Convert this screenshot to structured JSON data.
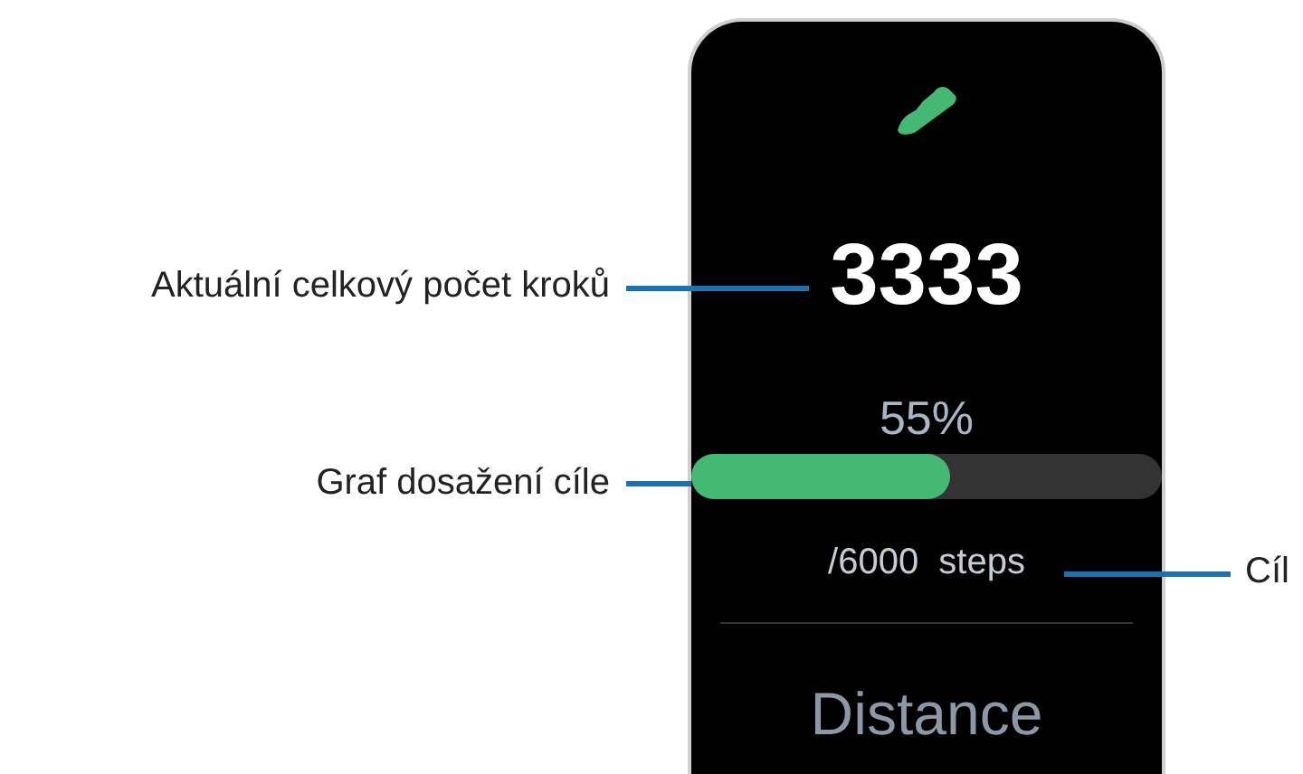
{
  "watch_screen": {
    "step_count": "3333",
    "progress_percent": "55%",
    "progress": {
      "level": 0.55
    },
    "goal": "/6000  steps",
    "next_section": "Distance"
  },
  "callouts": [
    {
      "text": "Aktuální celkový počet kroků"
    },
    {
      "text": "Graf dosažení cíle"
    },
    {
      "text": "Cíl"
    }
  ]
}
